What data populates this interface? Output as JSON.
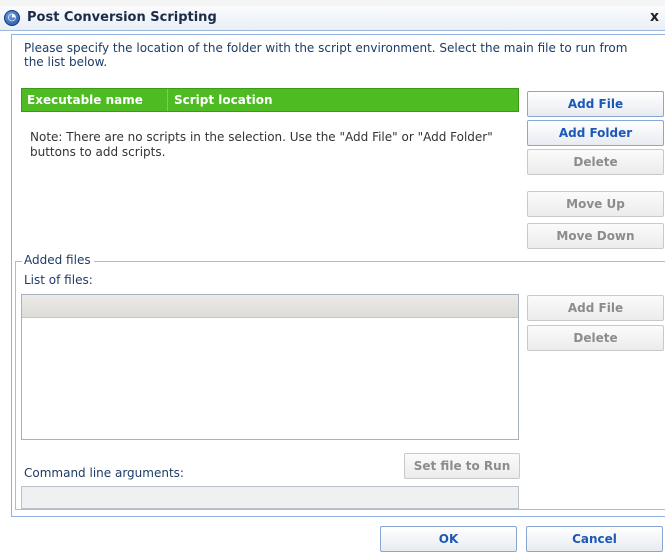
{
  "window": {
    "title": "Post Conversion Scripting",
    "close_glyph": "x"
  },
  "description": "Please specify the location of the folder with the script environment. Select the main file to run from the list below.",
  "scripts_table": {
    "columns": [
      "Executable name",
      "Script location"
    ],
    "empty_note": "Note: There are no scripts in the selection. Use the \"Add File\" or \"Add Folder\" buttons to add scripts."
  },
  "script_buttons": {
    "add_file": "Add File",
    "add_folder": "Add Folder",
    "delete": "Delete",
    "move_up": "Move Up",
    "move_down": "Move Down"
  },
  "added_files": {
    "group_label": "Added files",
    "list_label": "List of files:",
    "add_file": "Add File",
    "delete": "Delete",
    "set_file_to_run": "Set file to Run",
    "cmd_label": "Command line arguments:",
    "cmd_value": ""
  },
  "footer": {
    "ok": "OK",
    "cancel": "Cancel"
  },
  "colors": {
    "header_green": "#4dbb21",
    "accent_blue": "#1b58b8",
    "frame_blue": "#8fb0e0"
  }
}
